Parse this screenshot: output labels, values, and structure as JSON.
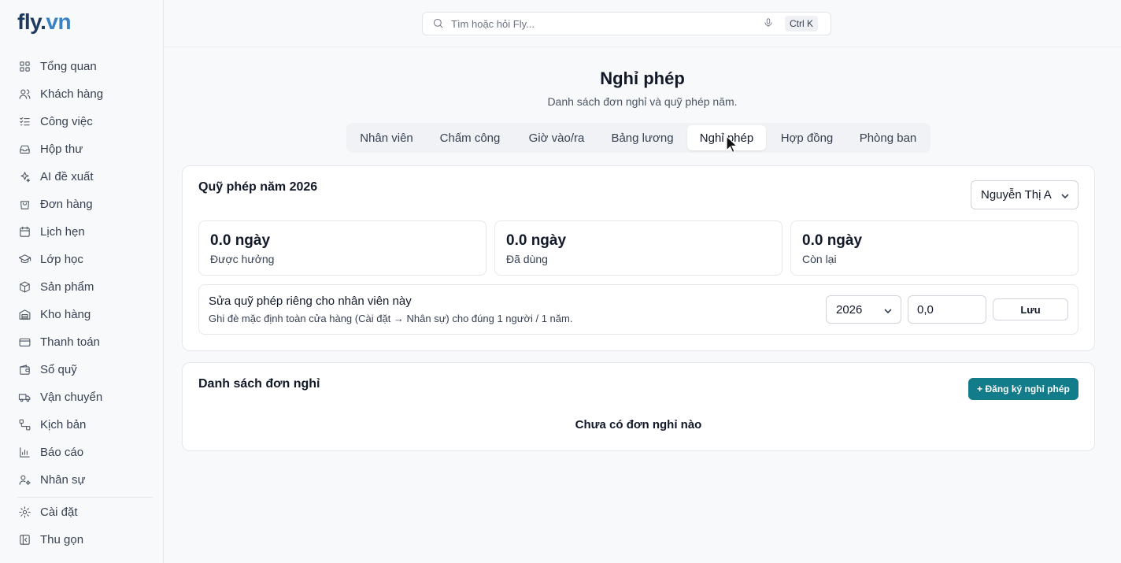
{
  "brand": {
    "part1": "fly",
    "part2": ".",
    "part3": "vn"
  },
  "search": {
    "placeholder": "Tìm hoặc hỏi Fly...",
    "shortcut": "Ctrl K"
  },
  "sidebar": {
    "items": [
      {
        "label": "Tổng quan",
        "icon": "grid-icon"
      },
      {
        "label": "Khách hàng",
        "icon": "users-icon"
      },
      {
        "label": "Công việc",
        "icon": "tasks-icon"
      },
      {
        "label": "Hộp thư",
        "icon": "inbox-icon"
      },
      {
        "label": "AI đề xuất",
        "icon": "sparkles-icon"
      },
      {
        "label": "Đơn hàng",
        "icon": "bag-icon"
      },
      {
        "label": "Lịch hẹn",
        "icon": "calendar-icon"
      },
      {
        "label": "Lớp học",
        "icon": "graduation-cap-icon"
      },
      {
        "label": "Sản phẩm",
        "icon": "box-icon"
      },
      {
        "label": "Kho hàng",
        "icon": "warehouse-icon"
      },
      {
        "label": "Thanh toán",
        "icon": "credit-card-icon"
      },
      {
        "label": "Sổ quỹ",
        "icon": "wallet-icon"
      },
      {
        "label": "Vận chuyển",
        "icon": "truck-icon"
      },
      {
        "label": "Kịch bản",
        "icon": "workflow-icon"
      },
      {
        "label": "Báo cáo",
        "icon": "bar-chart-icon"
      },
      {
        "label": "Nhân sự",
        "icon": "user-cog-icon"
      }
    ],
    "bottom": [
      {
        "label": "Cài đặt",
        "icon": "gear-icon"
      },
      {
        "label": "Thu gọn",
        "icon": "collapse-icon"
      }
    ]
  },
  "header": {
    "title": "Nghỉ phép",
    "subtitle": "Danh sách đơn nghỉ và quỹ phép năm."
  },
  "tabs": [
    {
      "label": "Nhân viên",
      "active": false
    },
    {
      "label": "Chấm công",
      "active": false
    },
    {
      "label": "Giờ vào/ra",
      "active": false
    },
    {
      "label": "Bảng lương",
      "active": false
    },
    {
      "label": "Nghỉ phép",
      "active": true
    },
    {
      "label": "Hợp đồng",
      "active": false
    },
    {
      "label": "Phòng ban",
      "active": false
    }
  ],
  "quota": {
    "title": "Quỹ phép năm 2026",
    "employee": "Nguyễn Thị A",
    "stats": [
      {
        "value": "0.0 ngày",
        "label": "Được hưởng"
      },
      {
        "value": "0.0 ngày",
        "label": "Đã dùng"
      },
      {
        "value": "0.0 ngày",
        "label": "Còn lại"
      }
    ],
    "override": {
      "title": "Sửa quỹ phép riêng cho nhân viên này",
      "desc": "Ghi đè mặc định toàn cửa hàng (Cài đặt → Nhân sự) cho đúng 1 người / 1 năm.",
      "year": "2026",
      "days": "0,0",
      "save_label": "Lưu"
    }
  },
  "requests": {
    "title": "Danh sách đơn nghỉ",
    "add_label": "+ Đăng ký nghỉ phép",
    "empty_text": "Chưa có đơn nghỉ nào"
  },
  "colors": {
    "accent": "#137c8b",
    "brand_dark": "#1e3a5f",
    "brand_light": "#3b82c4"
  }
}
